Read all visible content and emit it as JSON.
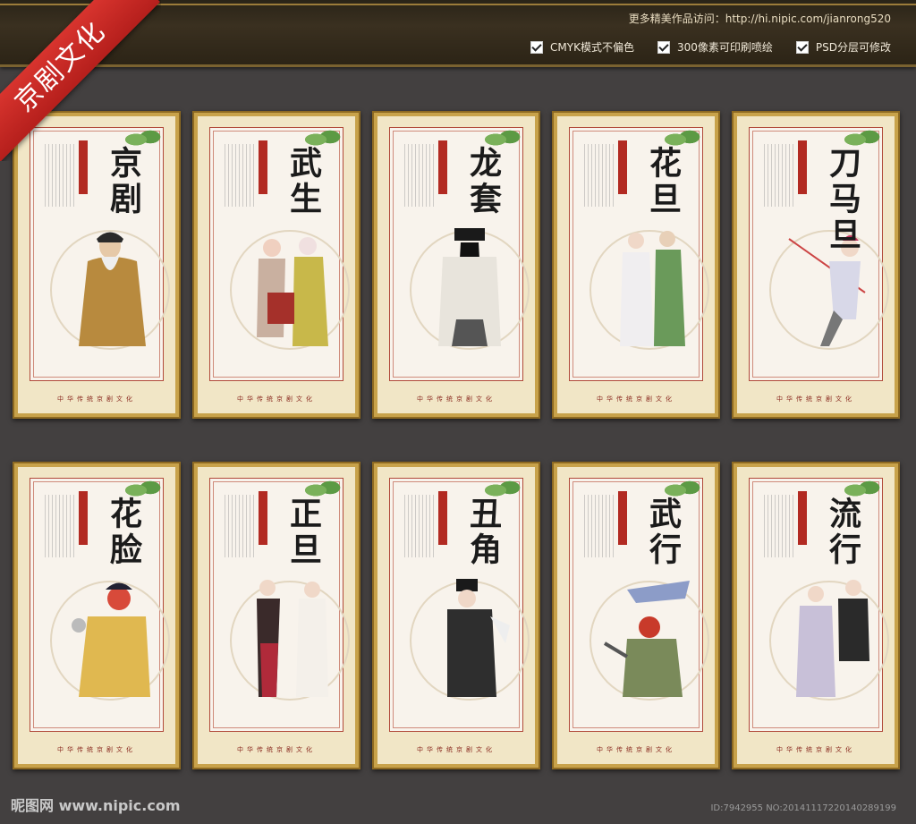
{
  "banner": {
    "text": "京剧文化"
  },
  "header": {
    "more_text": "更多精美作品访问：http://hi.nipic.com/jianrong520",
    "options": [
      "CMYK模式不偏色",
      "300像素可印刷喷绘",
      "PSD分层可修改"
    ]
  },
  "panels": [
    {
      "title": "京剧"
    },
    {
      "title": "武生"
    },
    {
      "title": "龙套"
    },
    {
      "title": "花旦"
    },
    {
      "title": "刀马旦"
    },
    {
      "title": "花脸"
    },
    {
      "title": "正旦"
    },
    {
      "title": "丑角"
    },
    {
      "title": "武行"
    },
    {
      "title": "流行"
    }
  ],
  "panel_footer": "中华传统京剧文化",
  "watermark": "昵图网 www.nipic.com",
  "image_id": "ID:7942955 NO:20141117220140289199",
  "colors": {
    "background": "#434040",
    "frame": "#c8a24a",
    "ribbon": "#d0302a"
  }
}
